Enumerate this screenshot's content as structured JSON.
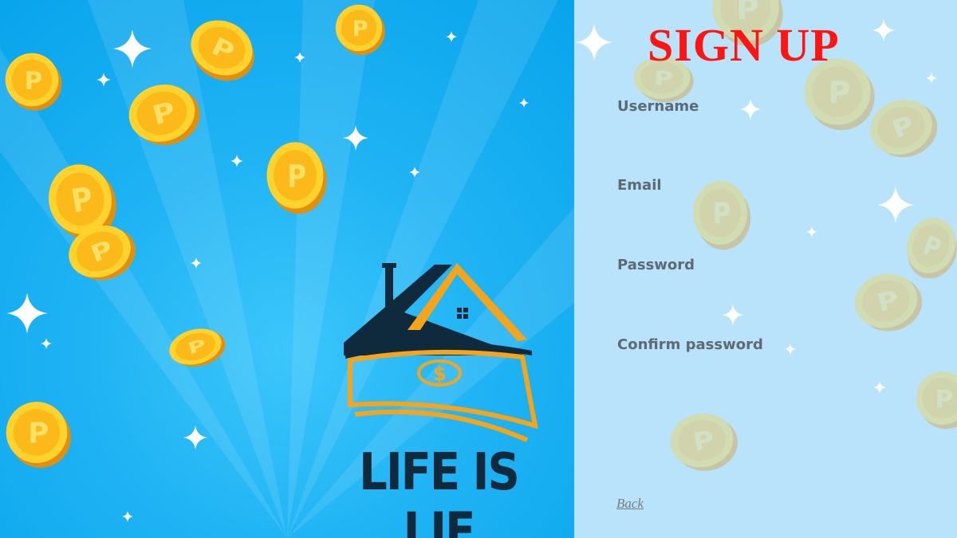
{
  "brand": {
    "name": "LIFE IS LIE",
    "logo_symbol": "$"
  },
  "form": {
    "title": "SIGN UP",
    "fields": [
      {
        "label": "Username",
        "value": "",
        "placeholder": ""
      },
      {
        "label": "Email",
        "value": "",
        "placeholder": ""
      },
      {
        "label": "Password",
        "value": "",
        "placeholder": ""
      },
      {
        "label": "Confirm password",
        "value": "",
        "placeholder": ""
      }
    ],
    "back_link": "Back"
  },
  "colors": {
    "title": "#ff1414",
    "left_bg": "#15aef2",
    "right_bg": "#b9e2fb",
    "coin": "#fcc419",
    "logo_navy": "#0f2a3d",
    "logo_orange": "#f5a41b"
  },
  "icons": {
    "coins": "p-coin-icon",
    "sparkles": "sparkle-icon",
    "logo": "house-money-logo"
  }
}
